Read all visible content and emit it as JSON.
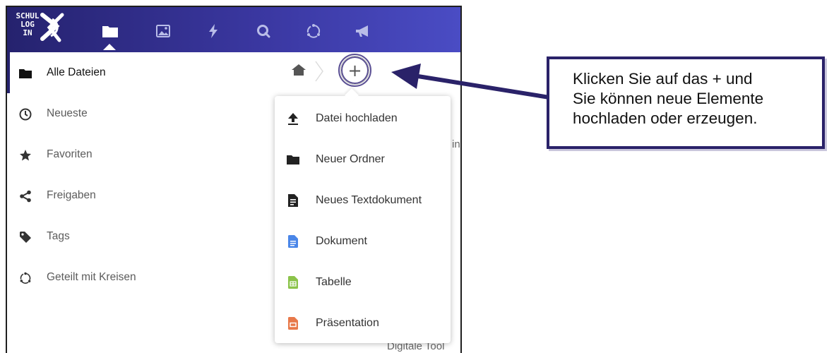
{
  "logo": {
    "lines": [
      "SCHUL",
      "LOG",
      "IN"
    ]
  },
  "topbar": {
    "apps": [
      {
        "icon": "folder-icon",
        "active": true
      },
      {
        "icon": "image-icon"
      },
      {
        "icon": "lightning-icon"
      },
      {
        "icon": "search-icon"
      },
      {
        "icon": "circles-icon"
      },
      {
        "icon": "megaphone-icon"
      }
    ]
  },
  "sidebar": {
    "items": [
      {
        "label": "Alle Dateien",
        "icon": "folder-icon",
        "active": true
      },
      {
        "label": "Neueste",
        "icon": "clock-icon"
      },
      {
        "label": "Favoriten",
        "icon": "star-icon"
      },
      {
        "label": "Freigaben",
        "icon": "share-icon"
      },
      {
        "label": "Tags",
        "icon": "tag-icon"
      },
      {
        "label": "Geteilt mit Kreisen",
        "icon": "circles-icon"
      }
    ]
  },
  "breadcrumb": {
    "add_label": "+"
  },
  "background_text": {
    "right_fragment": "in",
    "bottom_fragment": "Digitale Tool"
  },
  "new_menu": {
    "items": [
      {
        "label": "Datei hochladen",
        "icon": "upload-icon"
      },
      {
        "label": "Neuer Ordner",
        "icon": "folder-icon"
      },
      {
        "label": "Neues Textdokument",
        "icon": "text-file-icon"
      },
      {
        "label": "Dokument",
        "icon": "document-icon",
        "color": "#4a86e8"
      },
      {
        "label": "Tabelle",
        "icon": "spreadsheet-icon",
        "color": "#8bc34a"
      },
      {
        "label": "Präsentation",
        "icon": "presentation-icon",
        "color": "#e8794a"
      }
    ]
  },
  "callout": {
    "lines": [
      "Klicken Sie auf das + und",
      "Sie können neue Elemente",
      "hochladen oder erzeugen."
    ]
  },
  "colors": {
    "header_start": "#25226e",
    "header_end": "#4a4cc4",
    "callout_border": "#2a2269",
    "arrow": "#2a2269"
  }
}
